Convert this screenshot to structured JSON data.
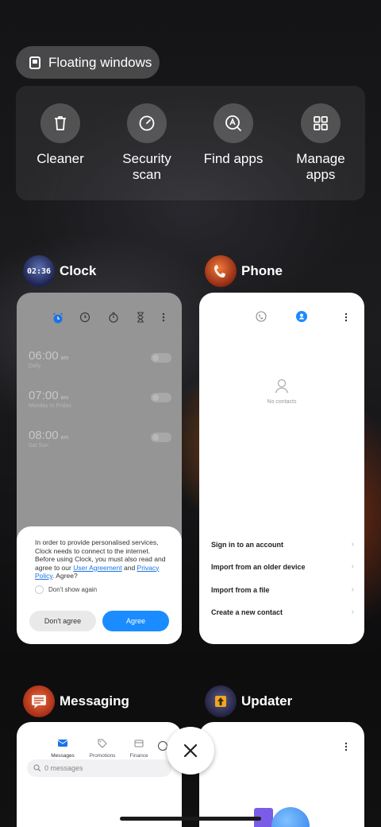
{
  "floating_windows": {
    "label": "Floating windows"
  },
  "tools": [
    {
      "label": "Cleaner",
      "icon": "trash-icon"
    },
    {
      "label": "Security\nscan",
      "icon": "gauge-icon"
    },
    {
      "label": "Find apps",
      "icon": "find-apps-icon"
    },
    {
      "label": "Manage\napps",
      "icon": "grid-icon"
    }
  ],
  "clock_app": {
    "name": "Clock",
    "icon_time": "02:36",
    "alarms": [
      {
        "time": "06:00",
        "ampm": "am",
        "repeat": "Daily"
      },
      {
        "time": "07:00",
        "ampm": "am",
        "repeat": "Monday to Friday"
      },
      {
        "time": "08:00",
        "ampm": "am",
        "repeat": "Sat Sun"
      }
    ],
    "dialog": {
      "text_before": "In order to provide personalised services, Clock needs to connect to the internet. Before using Clock, you must also read and agree to our ",
      "link1": "User Agreement",
      "and": " and ",
      "link2": "Privacy Policy",
      "text_after": ". Agree?",
      "dont_show": "Don't show again",
      "disagree": "Don't agree",
      "agree": "Agree"
    }
  },
  "phone_app": {
    "name": "Phone",
    "empty": "No contacts",
    "options": [
      "Sign in to an account",
      "Import from an older device",
      "Import from a file",
      "Create a new contact"
    ]
  },
  "messaging_app": {
    "name": "Messaging",
    "tabs": [
      "Messages",
      "Promotions",
      "Finance"
    ],
    "search_placeholder": "0 messages"
  },
  "updater_app": {
    "name": "Updater"
  },
  "colors": {
    "accent": "#1a8cff",
    "agree": "#1a8cff"
  }
}
